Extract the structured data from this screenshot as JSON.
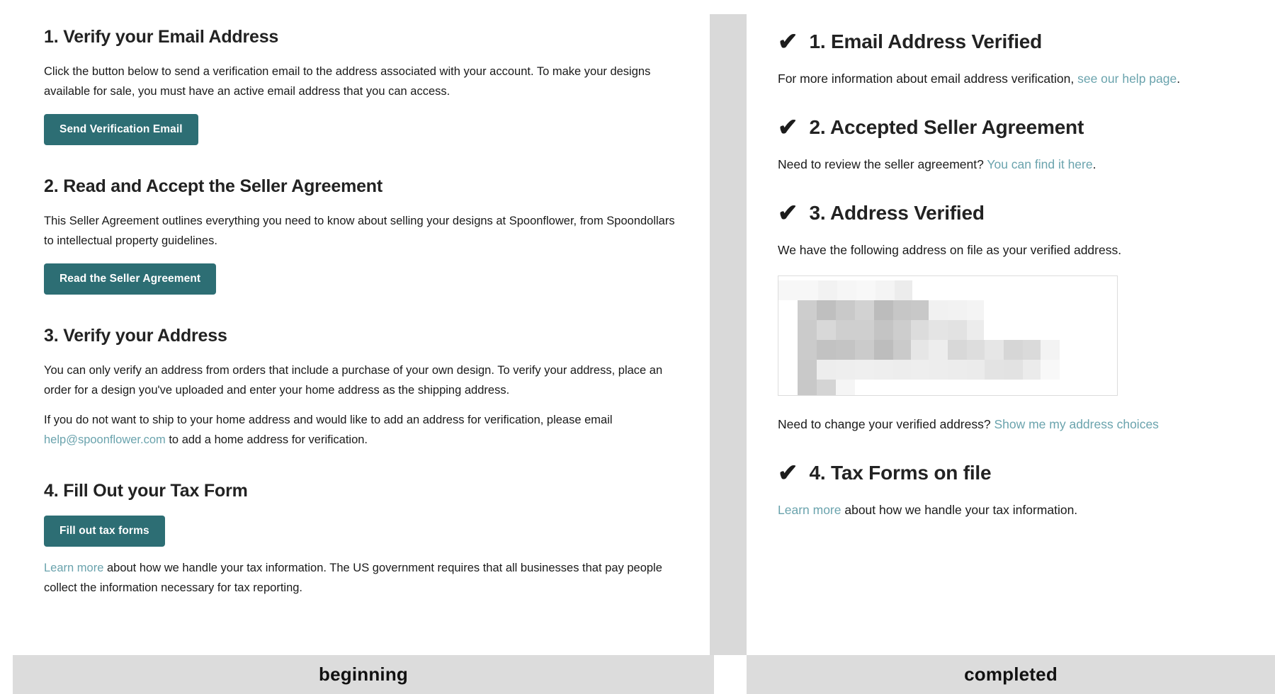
{
  "colors": {
    "button_teal": "#2d6e74",
    "link_teal": "#6aa3ad",
    "caption_bar": "#dcdcdc",
    "divider_gray": "#d9d9d9",
    "heading_text": "#222222",
    "body_text": "#1a1a1a"
  },
  "captions": {
    "left": "beginning",
    "right": "completed"
  },
  "left_panel": {
    "sections": [
      {
        "heading": "1. Verify your Email Address",
        "paragraph": "Click the button below to send a verification email to the address associated with your account. To make your designs available for sale, you must have an active email address that you can access.",
        "button_label": "Send Verification Email"
      },
      {
        "heading": "2. Read and Accept the Seller Agreement",
        "paragraph": "This Seller Agreement outlines everything you need to know about selling your designs at Spoonflower, from Spoondollars to intellectual property guidelines.",
        "button_label": "Read the Seller Agreement"
      },
      {
        "heading": "3. Verify your Address",
        "paragraph": "You can only verify an address from orders that include a purchase of your own design. To verify your address, place an order for a design you've uploaded and enter your home address as the shipping address.",
        "paragraph2_before_link": "If you do not want to ship to your home address and would like to add an address for verification, please email ",
        "paragraph2_link": "help@spoonflower.com",
        "paragraph2_after_link": " to add a home address for verification."
      },
      {
        "heading": "4. Fill Out your Tax Form",
        "button_label": "Fill out tax forms",
        "footnote_link": "Learn more",
        "footnote_after_link": " about how we handle your tax information. The US government requires that all businesses that pay people collect the information necessary for tax reporting."
      }
    ]
  },
  "right_panel": {
    "check_glyph": "✔",
    "sections": [
      {
        "heading": "1. Email Address Verified",
        "text_before_link": "For more information about email address verification, ",
        "link": "see our help page",
        "text_after_link": "."
      },
      {
        "heading": "2. Accepted Seller Agreement",
        "text_before_link": "Need to review the seller agreement? ",
        "link": "You can find it here",
        "text_after_link": "."
      },
      {
        "heading": "3. Address Verified",
        "text_before_link": "We have the following address on file as your verified address.",
        "link": "",
        "text_after_link": "",
        "address_card_redacted": true,
        "change_text_before_link": "Need to change your verified address? ",
        "change_link": "Show me my address choices"
      },
      {
        "heading": "4. Tax Forms on file",
        "text_before_link": "",
        "link": "Learn more",
        "text_after_link": " about how we handle your tax information."
      }
    ]
  }
}
